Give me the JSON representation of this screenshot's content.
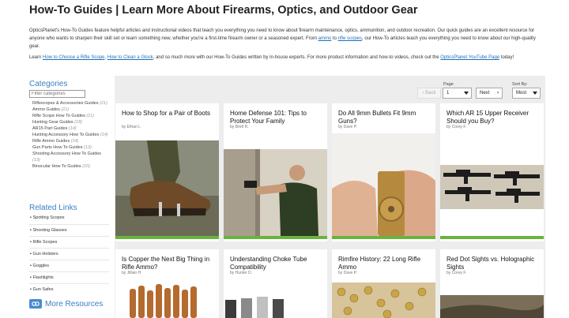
{
  "page": {
    "title": "How-To Guides | Learn More About Firearms, Optics, and Outdoor Gear"
  },
  "intro": {
    "p1_a": "OpticsPlanet's How-To Guides feature helpful articles and instructional videos that teach you everything you need to know about firearm maintenance, optics, ammunition, and outdoor recreation. Our quick guides are an excellent resource for anyone who wants to sharpen their skill set or learn something new, whether you're a first-time firearm owner or a seasoned expert. From ",
    "p1_link1": "ammo",
    "p1_b": " to ",
    "p1_link2": "rifle scopes",
    "p1_c": ", our How-To articles teach you everything you need to know about our high-quality gear.",
    "p2_a": "Learn ",
    "p2_link1": "How to Choose a Rifle Scope",
    "p2_b": ", ",
    "p2_link2": "How to Clean a Glock",
    "p2_c": ", and so much more with our How-To Guides written by in-house experts. For more product information and how-to videos, check out the ",
    "p2_link3": "OpticsPlanet YouTube Page",
    "p2_d": " today!"
  },
  "sidebar": {
    "categories_heading": "Categories",
    "filter_placeholder": "Filter categories",
    "categories": [
      {
        "name": "Riflescopes & Accessories Guides",
        "count": "(21)"
      },
      {
        "name": "Ammo Guides",
        "count": "(21)"
      },
      {
        "name": "Rifle Scope How To Guides",
        "count": "(21)"
      },
      {
        "name": "Hunting Gear Guides",
        "count": "(18)"
      },
      {
        "name": "AR15 Part Guides",
        "count": "(14)"
      },
      {
        "name": "Hunting Accessory How To Guides",
        "count": "(14)"
      },
      {
        "name": "Rifle Ammo Guides",
        "count": "(14)"
      },
      {
        "name": "Gun Parts How To Guides",
        "count": "(13)"
      },
      {
        "name": "Shooting Accessory How To Guides",
        "count": "(13)"
      },
      {
        "name": "Binocular How To Guides",
        "count": "(10)"
      }
    ],
    "related_heading": "Related Links",
    "related_links": [
      "Spotting Scopes",
      "Shooting Glasses",
      "Rifle Scopes",
      "Gun Holsters",
      "Goggles",
      "Flashlights",
      "Gun Safes"
    ],
    "more_resources": "More Resources"
  },
  "pager": {
    "page_label": "Page",
    "sort_label": "Sort By:",
    "back_label": "Back",
    "page_value": "1",
    "next_label": "Next",
    "sort_value": "Most"
  },
  "articles": [
    {
      "title": "How to Shop for a Pair of Boots",
      "author": "by Ethan L"
    },
    {
      "title": "Home Defense 101: Tips to Protect Your Family",
      "author": "by Brett R."
    },
    {
      "title": "Do All 9mm Bullets Fit 9mm Guns?",
      "author": "by Dave P."
    },
    {
      "title": "Which AR 15 Upper Receiver Should you Buy?",
      "author": "by Corey F."
    },
    {
      "title": "Is Copper the Next Big Thing in Rifle Ammo?",
      "author": "by Jillian H"
    },
    {
      "title": "Understanding Choke Tube Compatibility",
      "author": "by Hunter D."
    },
    {
      "title": "Rimfire History: 22 Long Rifle Ammo",
      "author": "by Dave P."
    },
    {
      "title": "Red Dot Sights vs. Holographic Sights",
      "author": "by Corey F."
    }
  ],
  "colors": {
    "accent_green": "#6ab43e",
    "link_blue": "#1e6fb8",
    "heading_blue": "#3a7fc4"
  }
}
